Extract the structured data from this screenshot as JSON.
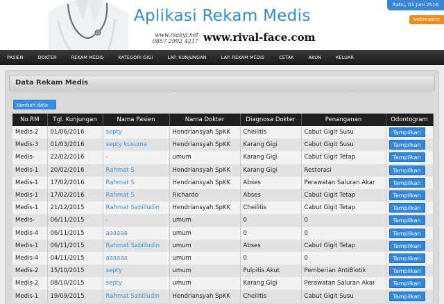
{
  "header": {
    "app_title": "Aplikasi Rekam Medis",
    "contact_site": "www.rsabyi.net",
    "contact_phone": "0857 2992 4217",
    "site_url": "www.rival-face.com",
    "date": "Rabu, 01 Juni 2016",
    "webmaster_label": "webmaster"
  },
  "nav": {
    "items": [
      "PASIEN",
      "DOKTER",
      "REKAM MEDIS",
      "KATEGORI GIGI",
      "LAP. KUNJUNGAN",
      "LAP. REKAM MEDIS",
      "CETAK",
      "AKUN",
      "KELUAR"
    ]
  },
  "panel": {
    "title": "Data Rekam Medis",
    "add_label": "tambah data"
  },
  "table": {
    "columns": [
      "No.RM",
      "Tgl. Kunjungan",
      "Nama Pasien",
      "Nama Dokter",
      "Diagnosa Dokter",
      "Penanganan",
      "Odontogram"
    ],
    "action_label": "Tampilkan",
    "rows": [
      {
        "rm": "Medis-2",
        "date": "01/06/2016",
        "patient": "septy",
        "doctor": "Hendriansyah SpKK",
        "diagnosis": "Cheilitis",
        "treatment": "Cabut Gigit Susu"
      },
      {
        "rm": "Medis-3",
        "date": "01/03/2016",
        "patient": "septy kusuma",
        "doctor": "Hendriansyah SpKK",
        "diagnosis": "Karang Gigi",
        "treatment": "Cabut Gigit Susu"
      },
      {
        "rm": "Medis-",
        "date": "22/02/2016",
        "patient": "-",
        "doctor": "umum",
        "diagnosis": "Karang Gigi",
        "treatment": "Cabut Gigit Tetap"
      },
      {
        "rm": "Medis-1",
        "date": "20/02/2016",
        "patient": "Rahmat S",
        "doctor": "Hendriansyah SpKK",
        "diagnosis": "Karang Gigi",
        "treatment": "Restorasi"
      },
      {
        "rm": "Medis-1",
        "date": "17/02/2016",
        "patient": "Rahmat S",
        "doctor": "Hendriansyah SpKK",
        "diagnosis": "Abses",
        "treatment": "Perawatan Saluran Akar"
      },
      {
        "rm": "Medis-1",
        "date": "17/02/2016",
        "patient": "Rahmat S",
        "doctor": "Richardo",
        "diagnosis": "Abses",
        "treatment": "Cabut Gigit Tetap"
      },
      {
        "rm": "Medis-1",
        "date": "21/12/2015",
        "patient": "Rahmat Sabilludin",
        "doctor": "Hendriansyah SpKK",
        "diagnosis": "Cheilitis",
        "treatment": "Cabut Gigit Tetap"
      },
      {
        "rm": "Medis-",
        "date": "06/11/2015",
        "patient": "-",
        "doctor": "umum",
        "diagnosis": "0",
        "treatment": "0"
      },
      {
        "rm": "Medis-4",
        "date": "06/11/2015",
        "patient": "aaaaaa",
        "doctor": "umum",
        "diagnosis": "0",
        "treatment": "0"
      },
      {
        "rm": "Medis-1",
        "date": "06/11/2015",
        "patient": "Rahmat Sabilludin",
        "doctor": "umum",
        "diagnosis": "Abses",
        "treatment": "Cabut Gigit Tetap"
      },
      {
        "rm": "Medis-4",
        "date": "04/11/2015",
        "patient": "aaaaaa",
        "doctor": "umum",
        "diagnosis": "0",
        "treatment": "0"
      },
      {
        "rm": "Medis-2",
        "date": "15/10/2015",
        "patient": "septy",
        "doctor": "umum",
        "diagnosis": "Pulpitis Akut",
        "treatment": "Pemberian AntiBiotik"
      },
      {
        "rm": "Medis-2",
        "date": "08/10/2015",
        "patient": "septy",
        "doctor": "umum",
        "diagnosis": "Karang Gigi",
        "treatment": "Perawatan Saluran Akar"
      },
      {
        "rm": "Medis-1",
        "date": "19/09/2015",
        "patient": "Rahmat Sabilludin",
        "doctor": "Hendriansyah SpKK",
        "diagnosis": "Cheilitis",
        "treatment": "Cabut Gigit Susu"
      }
    ]
  }
}
